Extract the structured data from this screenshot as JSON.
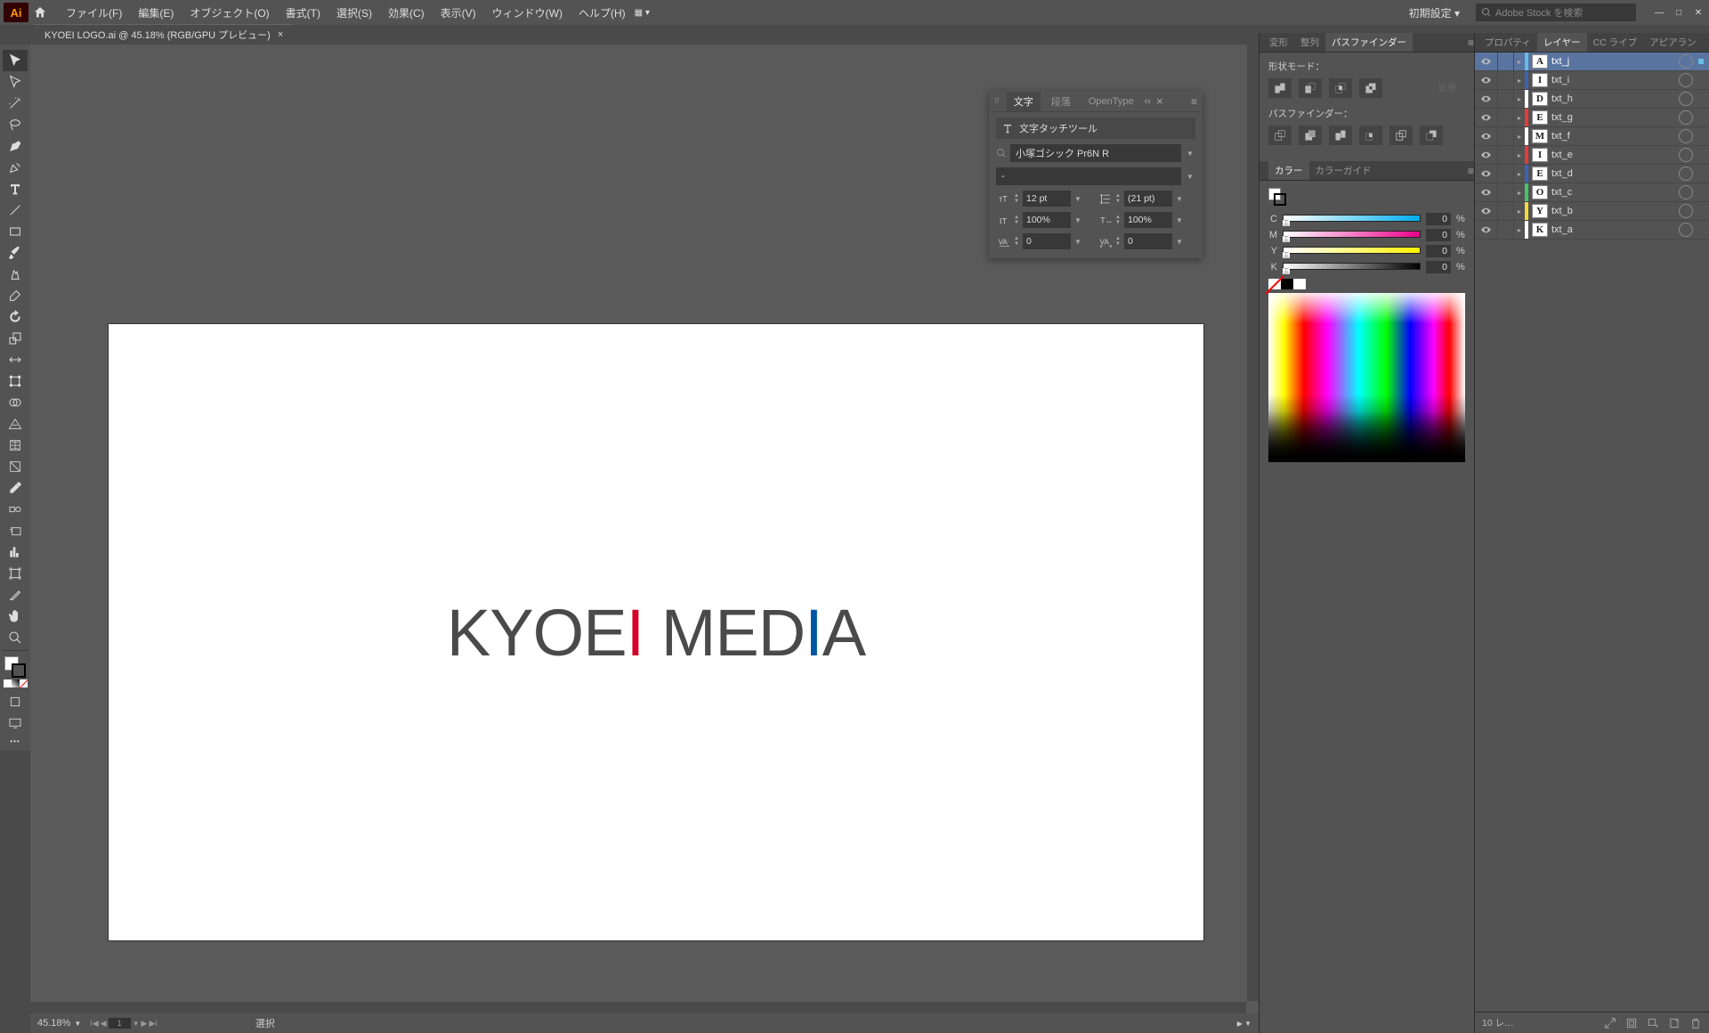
{
  "menubar": {
    "items": [
      "ファイル(F)",
      "編集(E)",
      "オブジェクト(O)",
      "書式(T)",
      "選択(S)",
      "効果(C)",
      "表示(V)",
      "ウィンドウ(W)",
      "ヘルプ(H)"
    ],
    "workspace": "初期設定",
    "search_placeholder": "Adobe Stock を検索"
  },
  "doc_tab": {
    "label": "KYOEI LOGO.ai @ 45.18% (RGB/GPU プレビュー)"
  },
  "artboard": {
    "k": "K",
    "y": "Y",
    "o": "O",
    "e": "E",
    "i1": "I",
    "sp": " ",
    "m": "M",
    "e2": "E",
    "d": "D",
    "i2": "I",
    "a": "A"
  },
  "status": {
    "zoom": "45.18%",
    "page": "1",
    "mode": "選択"
  },
  "char_panel": {
    "tabs": [
      "文字",
      "段落",
      "OpenType"
    ],
    "touch_tool": "文字タッチツール",
    "font": "小塚ゴシック Pr6N R",
    "style": "-",
    "size": "12 pt",
    "leading": "(21 pt)",
    "vscale": "100%",
    "hscale": "100%",
    "kerning": "0",
    "tracking": "0"
  },
  "pathfinder": {
    "tabs": [
      "変形",
      "整列",
      "パスファインダー"
    ],
    "shape_label": "形状モード：",
    "pf_label": "パスファインダー：",
    "expand": "拡張"
  },
  "color": {
    "tabs": [
      "カラー",
      "カラーガイド"
    ],
    "c": "0",
    "m": "0",
    "y": "0",
    "k": "0",
    "pct": "%"
  },
  "layers_panel": {
    "tabs": [
      "プロパティ",
      "レイヤー",
      "CC ライブ",
      "アピアラン"
    ],
    "items": [
      {
        "name": "txt_j",
        "thumb": "A",
        "color": "#65bce8",
        "selected": true
      },
      {
        "name": "txt_i",
        "thumb": "I",
        "color": "#3a62b7",
        "selected": false
      },
      {
        "name": "txt_h",
        "thumb": "D",
        "color": "#ffffff",
        "selected": false
      },
      {
        "name": "txt_g",
        "thumb": "E",
        "color": "#e53a3a",
        "selected": false
      },
      {
        "name": "txt_f",
        "thumb": "M",
        "color": "#ffffff",
        "selected": false
      },
      {
        "name": "txt_e",
        "thumb": "I",
        "color": "#e53a3a",
        "selected": false
      },
      {
        "name": "txt_d",
        "thumb": "E",
        "color": "#3a62b7",
        "selected": false
      },
      {
        "name": "txt_c",
        "thumb": "O",
        "color": "#49c36a",
        "selected": false
      },
      {
        "name": "txt_b",
        "thumb": "Y",
        "color": "#f4d93a",
        "selected": false
      },
      {
        "name": "txt_a",
        "thumb": "K",
        "color": "#ffffff",
        "selected": false
      }
    ],
    "footer": "10 レ…"
  }
}
